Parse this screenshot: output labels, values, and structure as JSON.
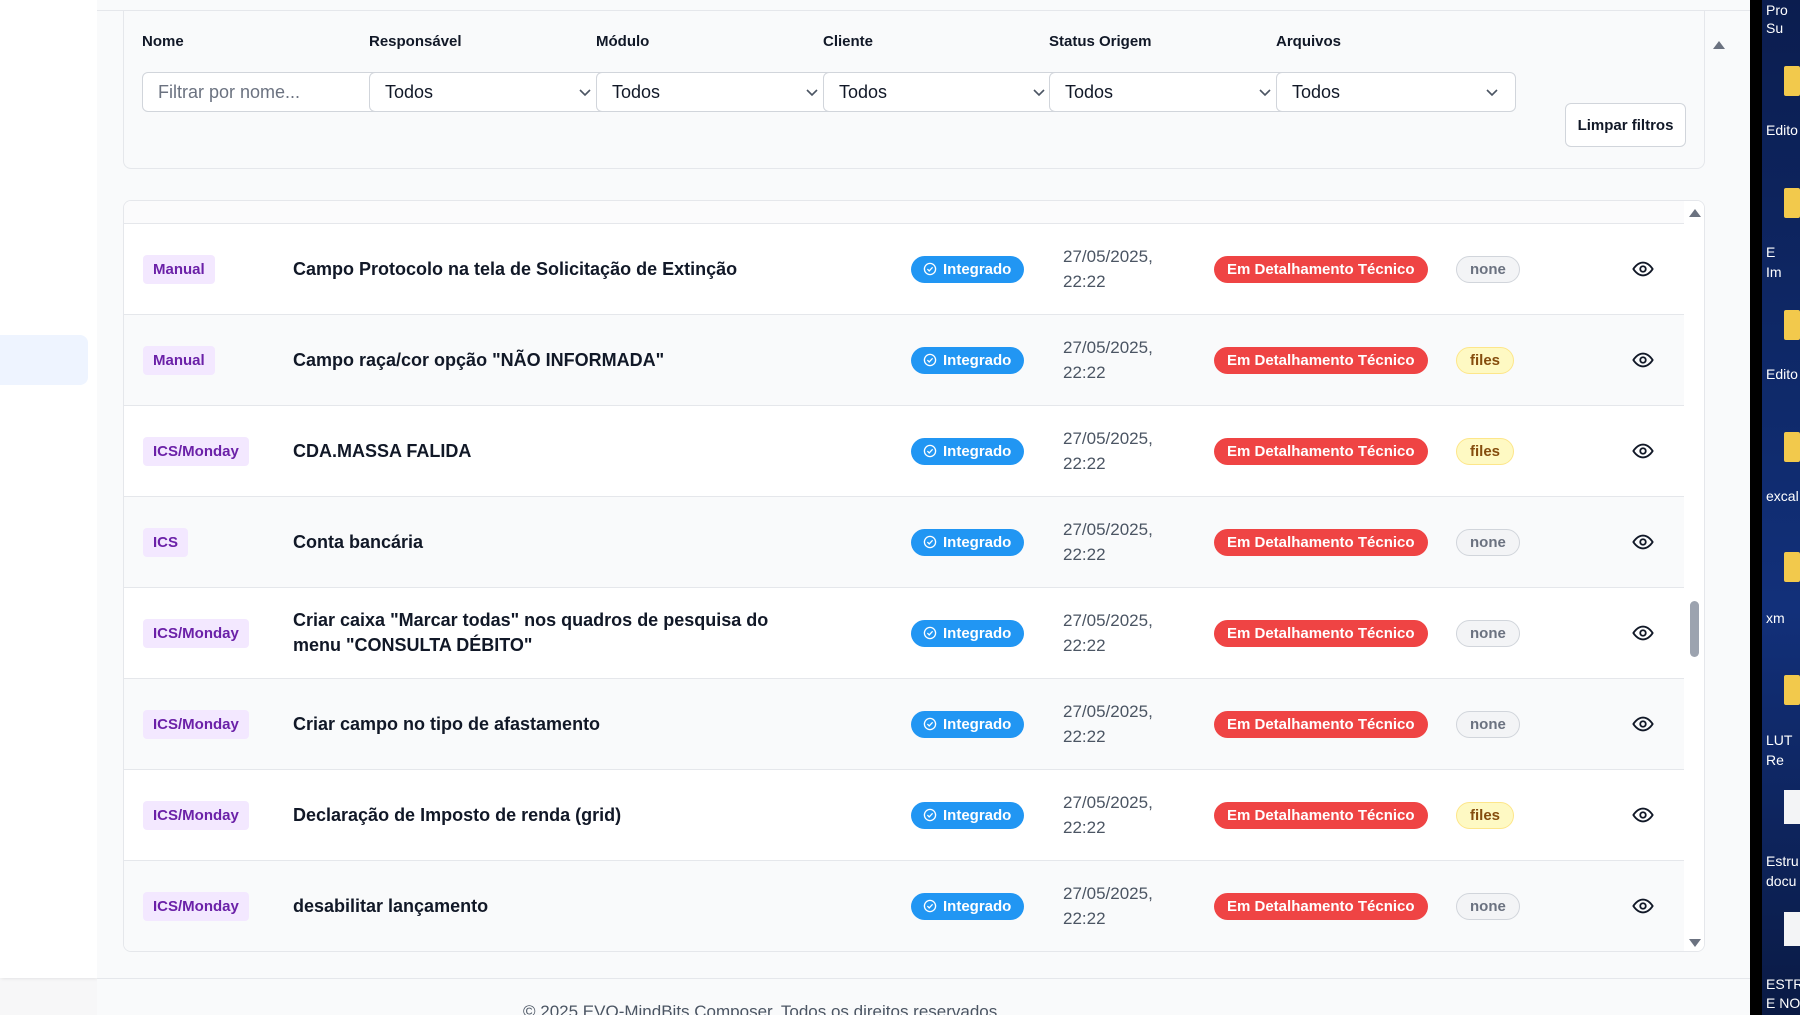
{
  "filters": {
    "nome": {
      "label": "Nome",
      "placeholder": "Filtrar por nome..."
    },
    "responsavel": {
      "label": "Responsável",
      "value": "Todos"
    },
    "modulo": {
      "label": "Módulo",
      "value": "Todos"
    },
    "cliente": {
      "label": "Cliente",
      "value": "Todos"
    },
    "status_origem": {
      "label": "Status Origem",
      "value": "Todos"
    },
    "arquivos": {
      "label": "Arquivos",
      "value": "Todos"
    },
    "clear_label": "Limpar filtros"
  },
  "rows": [
    {
      "origin": "Manual",
      "title": "Campo Protocolo na tela de Solicitação de Extinção",
      "integration": "Integrado",
      "date": "27/05/2025,",
      "time": "22:22",
      "status": "Em Detalhamento Técnico",
      "files": "none"
    },
    {
      "origin": "Manual",
      "title": "Campo raça/cor opção \"NÃO INFORMADA\"",
      "integration": "Integrado",
      "date": "27/05/2025,",
      "time": "22:22",
      "status": "Em Detalhamento Técnico",
      "files": "files"
    },
    {
      "origin": "ICS/Monday",
      "title": "CDA.MASSA FALIDA",
      "integration": "Integrado",
      "date": "27/05/2025,",
      "time": "22:22",
      "status": "Em Detalhamento Técnico",
      "files": "files"
    },
    {
      "origin": "ICS",
      "title": "Conta bancária",
      "integration": "Integrado",
      "date": "27/05/2025,",
      "time": "22:22",
      "status": "Em Detalhamento Técnico",
      "files": "none"
    },
    {
      "origin": "ICS/Monday",
      "title": "Criar caixa \"Marcar todas\" nos quadros de pesquisa do menu \"CONSULTA DÉBITO\"",
      "integration": "Integrado",
      "date": "27/05/2025,",
      "time": "22:22",
      "status": "Em Detalhamento Técnico",
      "files": "none"
    },
    {
      "origin": "ICS/Monday",
      "title": "Criar campo no tipo de afastamento",
      "integration": "Integrado",
      "date": "27/05/2025,",
      "time": "22:22",
      "status": "Em Detalhamento Técnico",
      "files": "none"
    },
    {
      "origin": "ICS/Monday",
      "title": "Declaração de Imposto de renda (grid)",
      "integration": "Integrado",
      "date": "27/05/2025,",
      "time": "22:22",
      "status": "Em Detalhamento Técnico",
      "files": "files"
    },
    {
      "origin": "ICS/Monday",
      "title": "desabilitar lançamento",
      "integration": "Integrado",
      "date": "27/05/2025,",
      "time": "22:22",
      "status": "Em Detalhamento Técnico",
      "files": "none"
    }
  ],
  "footer": "© 2025 EVO-MindBits Composer. Todos os direitos reservados.",
  "desktop": {
    "labels": [
      "Pro",
      "Su",
      "Edito",
      "E",
      "Im",
      "Edito",
      "excal",
      "xm",
      "LUT",
      "Re",
      "Estru",
      "docu",
      "ESTR",
      "E NO"
    ]
  },
  "colors": {
    "integrated": "#2196f3",
    "status_red": "#ef4444",
    "origin_bg": "#f3e8ff",
    "origin_text": "#6b21a8",
    "files_bg": "#fef9c3"
  }
}
